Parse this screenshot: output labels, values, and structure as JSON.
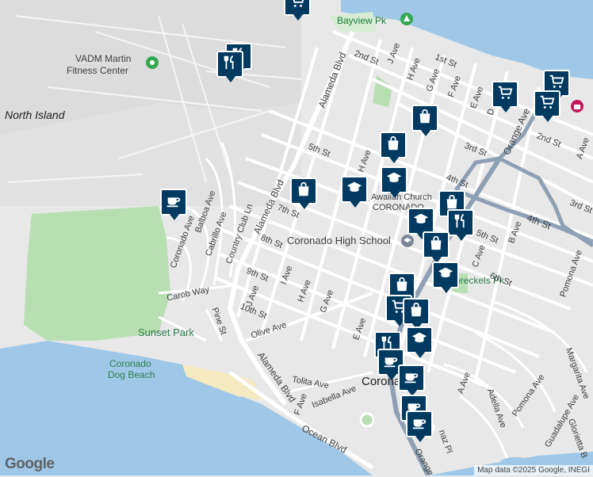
{
  "map": {
    "labels": {
      "north_island": "North Island",
      "vadm_line1": "VADM Martin",
      "vadm_line2": "Fitness Center",
      "bayview_pk": "Bayview Pk",
      "coronado_high_school": "Coronado High School",
      "sunset_park": "Sunset Park",
      "dog_beach_line1": "Coronado",
      "dog_beach_line2": "Dog Beach",
      "spreckels_pk": "Spreckels Pk",
      "coronado_town": "Coronado",
      "hawaiian_church_1": "Awaiian Church",
      "hawaiian_church_2": "CORONADO"
    },
    "streets": {
      "alameda_blvd_n": "Alameda Blvd",
      "alameda_blvd_mid": "Alameda Blvd",
      "alameda_blvd_s": "Alameda Blvd",
      "orange_ave_n": "Orange Ave",
      "orange_ave_s": "Orange",
      "ocean_blvd": "Ocean Blvd",
      "st_1st": "1st St",
      "st_2nd_a": "2nd St",
      "st_2nd_b": "2nd St",
      "st_3rd_a": "3rd St",
      "st_3rd_b": "3rd St",
      "st_4th_a": "4th St",
      "st_4th_b": "4th St",
      "st_5th_a": "5th St",
      "st_5th_b": "5th St",
      "st_6th": "6th St",
      "st_7th": "7th St",
      "st_8th": "8th St",
      "st_9th": "9th St",
      "st_10th": "10th St",
      "j_ave_n": "J Ave",
      "j_ave_s": "J Ave",
      "i_ave_s": "I Ave",
      "h_ave_n": "H Ave",
      "h_ave_s": "H Ave",
      "h_ave_top": "H Ave",
      "g_ave_n": "G Ave",
      "g_ave_s": "G Ave",
      "f_ave_n": "F Ave",
      "f_ave_s": "F Ave",
      "e_ave_n": "E Ave",
      "e_ave_s": "E Ave",
      "d_ave": "D",
      "c_ave": "C Ave",
      "b_ave": "B Ave",
      "a_ave_n": "A Ave",
      "a_ave_s": "A Ave",
      "olive_ave": "Olive Ave",
      "tolita_ave": "Tolita Ave",
      "isabella_ave": "Isabella Ave",
      "pine_st": "Pine St",
      "carob_way": "Carob Way",
      "coronado_ave": "Coronado Ave",
      "balboa_ave": "Balboa Ave",
      "cabrillo_ave": "Cabrillo Ave",
      "country_club_ln": "Country Club Ln",
      "pomona_ave_n": "Pomona Ave",
      "pomona_ave_s": "Pomona Ave",
      "margarita_ave": "Margarita Ave",
      "guadalupe_ave": "Guadalupe Ave",
      "glorietta_blvd": "Glorietta B",
      "adella_ave": "Adella Ave",
      "juanez_pl": "naz Pl"
    },
    "markers": [
      {
        "id": "m1",
        "icon": "shopping-cart-icon"
      },
      {
        "id": "m2",
        "icon": "restaurant-icon"
      },
      {
        "id": "m3",
        "icon": "restaurant-icon"
      },
      {
        "id": "m4",
        "icon": "cafe-icon"
      },
      {
        "id": "m5",
        "icon": "shopping-bag-icon"
      },
      {
        "id": "m6",
        "icon": "school-icon"
      },
      {
        "id": "m7",
        "icon": "shopping-bag-icon"
      },
      {
        "id": "m8",
        "icon": "school-icon"
      },
      {
        "id": "m9",
        "icon": "shopping-bag-icon"
      },
      {
        "id": "m10",
        "icon": "shopping-cart-icon"
      },
      {
        "id": "m11",
        "icon": "shopping-cart-icon"
      },
      {
        "id": "m12",
        "icon": "shopping-cart-icon"
      },
      {
        "id": "m13",
        "icon": "shopping-bag-icon"
      },
      {
        "id": "m14",
        "icon": "school-icon"
      },
      {
        "id": "m15",
        "icon": "restaurant-icon"
      },
      {
        "id": "m16",
        "icon": "shopping-bag-icon"
      },
      {
        "id": "m17",
        "icon": "school-icon"
      },
      {
        "id": "m18",
        "icon": "shopping-bag-icon"
      },
      {
        "id": "m19",
        "icon": "shopping-cart-icon"
      },
      {
        "id": "m20",
        "icon": "shopping-bag-icon"
      },
      {
        "id": "m21",
        "icon": "school-icon"
      },
      {
        "id": "m22",
        "icon": "restaurant-icon"
      },
      {
        "id": "m23",
        "icon": "cafe-icon"
      },
      {
        "id": "m24",
        "icon": "cafe-icon"
      },
      {
        "id": "m25",
        "icon": "cafe-icon"
      },
      {
        "id": "m26",
        "icon": "cafe-icon"
      }
    ],
    "colors": {
      "water": "#9fc8e8",
      "land": "#e8e8e8",
      "park": "#b7dfb2",
      "beach": "#f5e9bf",
      "road": "#ffffff",
      "highway": "#8fa0b5",
      "pin": "#003a60"
    },
    "attribution": {
      "logo": "Google",
      "credit": "Map data ©2025 Google, INEGI"
    }
  }
}
